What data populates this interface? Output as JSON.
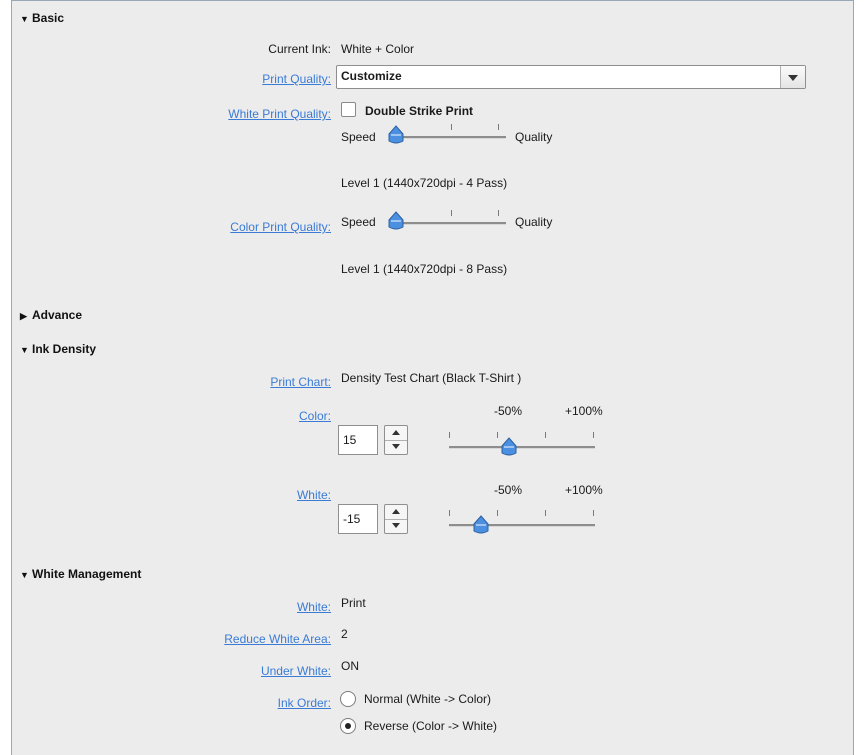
{
  "sections": {
    "basic": "Basic",
    "advance": "Advance",
    "ink_density": "Ink Density",
    "white_management": "White Management"
  },
  "basic": {
    "current_ink_label": "Current Ink:",
    "current_ink_value": "White + Color",
    "print_quality_label": "Print Quality:",
    "print_quality_value": "Customize",
    "white_print_quality_label": "White Print Quality:",
    "double_strike_label": "Double Strike Print",
    "double_strike_checked": false,
    "white_slider": {
      "min_label": "Speed",
      "max_label": "Quality",
      "level_index": 0,
      "tick_count": 3
    },
    "white_level_text": "Level 1 (1440x720dpi - 4 Pass)",
    "color_print_quality_label": "Color Print Quality:",
    "color_slider": {
      "min_label": "Speed",
      "max_label": "Quality",
      "level_index": 0,
      "tick_count": 3
    },
    "color_level_text": "Level 1 (1440x720dpi - 8 Pass)"
  },
  "ink_density": {
    "print_chart_label": "Print Chart:",
    "print_chart_value": "Density Test Chart (Black T-Shirt )",
    "color_label": "Color:",
    "color_value": "15",
    "color_min_label": "-50%",
    "color_max_label": "+100%",
    "white_label": "White:",
    "white_value": "-15",
    "white_min_label": "-50%",
    "white_max_label": "+100%"
  },
  "white_management": {
    "white_label": "White:",
    "white_value": "Print",
    "reduce_label": "Reduce White Area:",
    "reduce_value": "2",
    "under_label": "Under White:",
    "under_value": "ON",
    "ink_order_label": "Ink Order:",
    "ink_order_options": [
      "Normal (White -> Color)",
      "Reverse (Color -> White)"
    ],
    "ink_order_selected": 1
  },
  "colors": {
    "link": "#3a7bd5",
    "thumb": "#4a8fe0",
    "panel": "#ececec"
  }
}
